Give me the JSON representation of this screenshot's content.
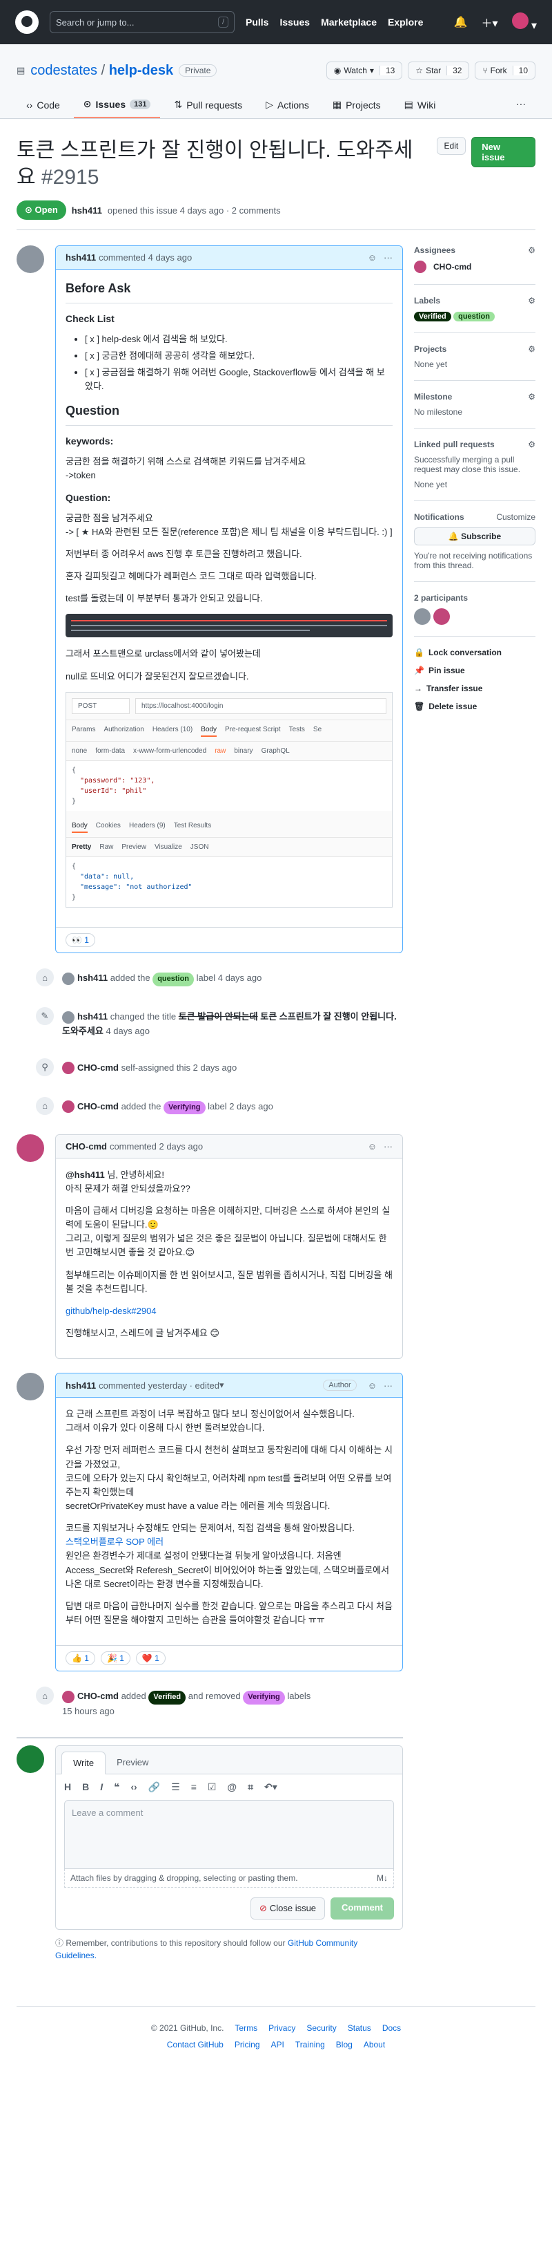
{
  "topbar": {
    "search_placeholder": "Search or jump to...",
    "slash": "/",
    "nav": [
      "Pulls",
      "Issues",
      "Marketplace",
      "Explore"
    ]
  },
  "repo": {
    "owner": "codestates",
    "sep": "/",
    "name": "help-desk",
    "visibility": "Private",
    "watch": "Watch",
    "watch_count": "13",
    "star": "Star",
    "star_count": "32",
    "fork": "Fork",
    "fork_count": "10"
  },
  "tabs": {
    "code": "Code",
    "issues": "Issues",
    "issues_count": "131",
    "pulls": "Pull requests",
    "actions": "Actions",
    "projects": "Projects",
    "wiki": "Wiki"
  },
  "issue": {
    "title": "토큰 스프린트가 잘 진행이 안됩니다. 도와주세요",
    "number": "#2915",
    "edit": "Edit",
    "new_issue": "New issue",
    "state": "Open",
    "meta_user": "hsh411",
    "meta_text": "opened this issue 4 days ago · 2 comments"
  },
  "c1": {
    "user": "hsh411",
    "when": "commented 4 days ago",
    "before_ask": "Before Ask",
    "checklist": "Check List",
    "items": [
      "[ x ] help-desk 에서 검색을 해 보았다.",
      "[ x ] 궁금한 점에대해 공공히 생각을 해보았다.",
      "[ x ] 궁금점을 해결하기 위해 어러번 Google, Stackoverflow등 에서 검색을 해 보았다."
    ],
    "question": "Question",
    "keywords": "keywords:",
    "kw_text": "궁금한 점을 해결하기 위해 스스로 검색해본 키워드를 남겨주세요",
    "kw_val": "->token",
    "q_label": "Question:",
    "q_text": "궁금한 점을 남겨주세요",
    "q_text2": "-> [ ★ HA와 관련된 모든 질문(reference 포함)은 제니 팀 채널을 이용 부탁드립니다. :) ]",
    "p1": "저번부터 종 어려우서 aws 진행 후 토큰을 진행하려고 했읍니다.",
    "p2": "혼자 길피됫길고 헤메다가 레퍼런스 코드 그대로 따라 입력했읍니다.",
    "p3": "test를 돌렸는데 이 부분부터 통과가 안되고 있읍니다.",
    "p4": "그래서 포스트맨으로 urclass에서와 같이 넣어봤는데",
    "p5": "null로 뜨네요 어디가 잘못된건지 잘모르겠습니다.",
    "pm_method": "POST",
    "pm_url": "https://localhost:4000/login",
    "pm_tabs": [
      "Params",
      "Authorization",
      "Headers (10)",
      "Body",
      "Pre-request Script",
      "Tests",
      "Se"
    ],
    "pm_body_opts": [
      "none",
      "form-data",
      "x-www-form-urlencoded",
      "raw",
      "binary",
      "GraphQL"
    ],
    "pm_req": [
      "{",
      "\"password\": \"123\",",
      "\"userId\": \"phil\"",
      "}"
    ],
    "pm_resp_tabs": [
      "Body",
      "Cookies",
      "Headers (9)",
      "Test Results"
    ],
    "pm_view": [
      "Pretty",
      "Raw",
      "Preview",
      "Visualize",
      "JSON"
    ],
    "pm_resp": [
      "{",
      "\"data\": null,",
      "\"message\": \"not authorized\"",
      "}"
    ],
    "reaction": "👀 1"
  },
  "events": [
    {
      "user": "hsh411",
      "pre": "added the",
      "label": "question",
      "post": "label 4 days ago"
    },
    {
      "user": "hsh411",
      "pre": "changed the title",
      "old": "토큰 발급이 안되는데",
      "new": "토큰 스프린트가 잘 진행이 안됩니다. 도와주세요",
      "post": "4 days ago"
    },
    {
      "user": "CHO-cmd",
      "pre": "self-assigned this 2 days ago"
    },
    {
      "user": "CHO-cmd",
      "pre": "added the",
      "label": "Verifying",
      "post": "label 2 days ago"
    }
  ],
  "c2": {
    "user": "CHO-cmd",
    "when": "commented 2 days ago",
    "mention": "@hsh411",
    "greet": " 님, 안녕하세요!",
    "l1": "아직 문제가 해결 안되셨을까요??",
    "l2": "마음이 급해서 디버깅을 요청하는 마음은 이해하지만, 디버깅은 스스로 하셔야 본인의 실력에 도움이 된답니다.🙂",
    "l3": "그리고, 이렇게 질문의 범위가 넓은 것은 좋은 질문법이 아닙니다. 질문법에 대해서도 한번 고민해보시면 좋을 것 같아요.😊",
    "l4": "첨부해드리는 이슈페이지를 한 번 읽어보시고, 질문 범위를 좁히시거나, 직접 디버깅을 해볼 것을 추천드립니다.",
    "link": "github/help-desk#2904",
    "l5": "진행해보시고, 스레드에 글 남겨주세요 😊"
  },
  "c3": {
    "user": "hsh411",
    "when": "commented yesterday · edited",
    "role": "Author",
    "l1": "요 근래 스프린트 과정이 너무 복잡하고 많다 보니 정신이없어서 실수했읍니다.",
    "l2": "그래서 이유가 있다 이용해 다시 한번 돌려보았습니다.",
    "l3": "우선 가장 먼저 레퍼런스 코드를 다시 천천히 살펴보고 동작원리에 대해 다시 이해하는 시간을 가졌었고,",
    "l4": "코드에 오타가 있는지 다시 확인해보고, 어러차례 npm test를 돌려보며 어떤 오류를 보여주는지 확인했는데",
    "l5": "secretOrPrivateKey must have a value 라는 에러를 계속 띄웠읍니다.",
    "l6": "코드를 지워보거나 수정해도 안되는 문제여서, 직접 검색을 통해 알아봤읍니다.",
    "link": "스택오버플로우 SOP 에러",
    "l7": "원인은 환경변수가 제대로 설정이 안됐다는걸 뒤늦게 알아냈읍니다. 처음엔 Access_Secret와 Referesh_Secret이 비어있어야 하는줄 알았는데, 스택오버플로에서 나온 대로 Secret이라는 환경 변수를 지정해줬습니다.",
    "l8": "답변 대로 마음이 급한나머지 실수를 한것 같습니다. 앞으로는 마음을 추스리고 다시 처음부터 어떤 질문을 해야할지 고민하는 습관을 들여야할것 같습니다 ㅠㅠ",
    "reactions": [
      "👍 1",
      "🎉 1",
      "❤️ 1"
    ]
  },
  "event_last": {
    "user": "CHO-cmd",
    "pre": "added",
    "label1": "Verified",
    "mid": "and removed",
    "label2": "Verifying",
    "post": "labels",
    "time": "15 hours ago"
  },
  "composer": {
    "write": "Write",
    "preview": "Preview",
    "placeholder": "Leave a comment",
    "attach": "Attach files by dragging & dropping, selecting or pasting them.",
    "close": "Close issue",
    "comment": "Comment",
    "guide": "Remember, contributions to this repository should follow our",
    "guide_link": "GitHub Community Guidelines."
  },
  "sidebar": {
    "assignees": "Assignees",
    "assignee": "CHO-cmd",
    "labels": "Labels",
    "label_verified": "Verified",
    "label_question": "question",
    "projects": "Projects",
    "projects_v": "None yet",
    "milestone": "Milestone",
    "milestone_v": "No milestone",
    "linked": "Linked pull requests",
    "linked_d": "Successfully merging a pull request may close this issue.",
    "linked_v": "None yet",
    "notifications": "Notifications",
    "customize": "Customize",
    "subscribe": "Subscribe",
    "notif_d": "You're not receiving notifications from this thread.",
    "participants": "2 participants",
    "lock": "Lock conversation",
    "pin": "Pin issue",
    "transfer": "Transfer issue",
    "delete": "Delete issue"
  },
  "footer": {
    "copyright": "© 2021 GitHub, Inc.",
    "row1": [
      "Terms",
      "Privacy",
      "Security",
      "Status",
      "Docs"
    ],
    "row2": [
      "Contact GitHub",
      "Pricing",
      "API",
      "Training",
      "Blog",
      "About"
    ]
  }
}
